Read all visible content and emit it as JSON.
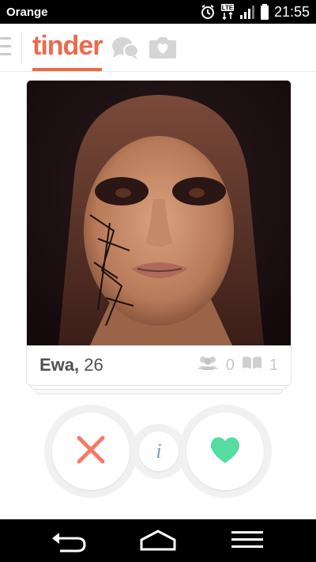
{
  "status_bar": {
    "carrier": "Orange",
    "time": "21:55",
    "network_label": "LTE",
    "icons": [
      "alarm-icon",
      "lte-icon",
      "signal-icon",
      "battery-icon"
    ]
  },
  "header": {
    "app_name": "tinder",
    "icons": [
      "menu-icon",
      "chat-icon",
      "moments-icon"
    ],
    "brand_color": "#eb6a4a"
  },
  "profile_card": {
    "name": "Ewa,",
    "age": "26",
    "shared_friends": "0",
    "shared_interests": "1",
    "photo_subject": "portrait-photo"
  },
  "actions": {
    "nope_icon": "x-icon",
    "info_label": "i",
    "like_icon": "heart-icon",
    "nope_color": "#f47c67",
    "info_color": "#6b9fd6",
    "like_color": "#55dca0"
  },
  "navbar": {
    "icons": [
      "back-icon",
      "home-icon",
      "recent-apps-icon"
    ]
  }
}
